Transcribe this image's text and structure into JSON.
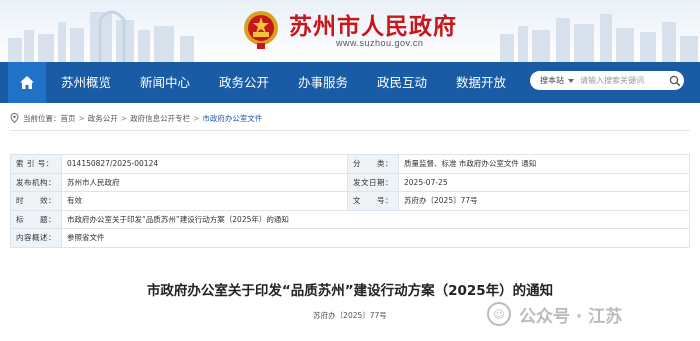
{
  "header": {
    "site_title": "苏州市人民政府",
    "site_url": "www.suzhou.gov.cn"
  },
  "nav": {
    "home_icon": "home-icon",
    "items": [
      "苏州概览",
      "新闻中心",
      "政务公开",
      "办事服务",
      "政民互动",
      "数据开放"
    ]
  },
  "search": {
    "category": "搜本站",
    "placeholder": "请输入搜索关键词"
  },
  "breadcrumb": {
    "prefix": "当前位置：",
    "items": [
      "首页",
      "政务公开",
      "政府信息公开专栏",
      "市政府办公室文件"
    ],
    "separator": ">"
  },
  "meta": {
    "rows": [
      {
        "k1": "索 引 号：",
        "v1": "014150827/2025-00124",
        "k2": "分　　类：",
        "v2": "质量监督、标准 市政府办公室文件 通知"
      },
      {
        "k1": "发布机构：",
        "v1": "苏州市人民政府",
        "k2": "发文日期：",
        "v2": "2025-07-25"
      },
      {
        "k1": "时　　效：",
        "v1": "有效",
        "k2": "文　　号：",
        "v2": "苏府办〔2025〕77号"
      }
    ],
    "title_label": "标　　题：",
    "title_value": "市政府办公室关于印发“品质苏州”建设行动方案（2025年）的通知",
    "summary_label": "内容概述：",
    "summary_value": "参照省文件"
  },
  "document": {
    "title": "市政府办公室关于印发“品质苏州”建设行动方案（2025年）的通知",
    "number": "苏府办〔2025〕77号"
  },
  "watermark": {
    "text": "公众号 · 江苏"
  }
}
